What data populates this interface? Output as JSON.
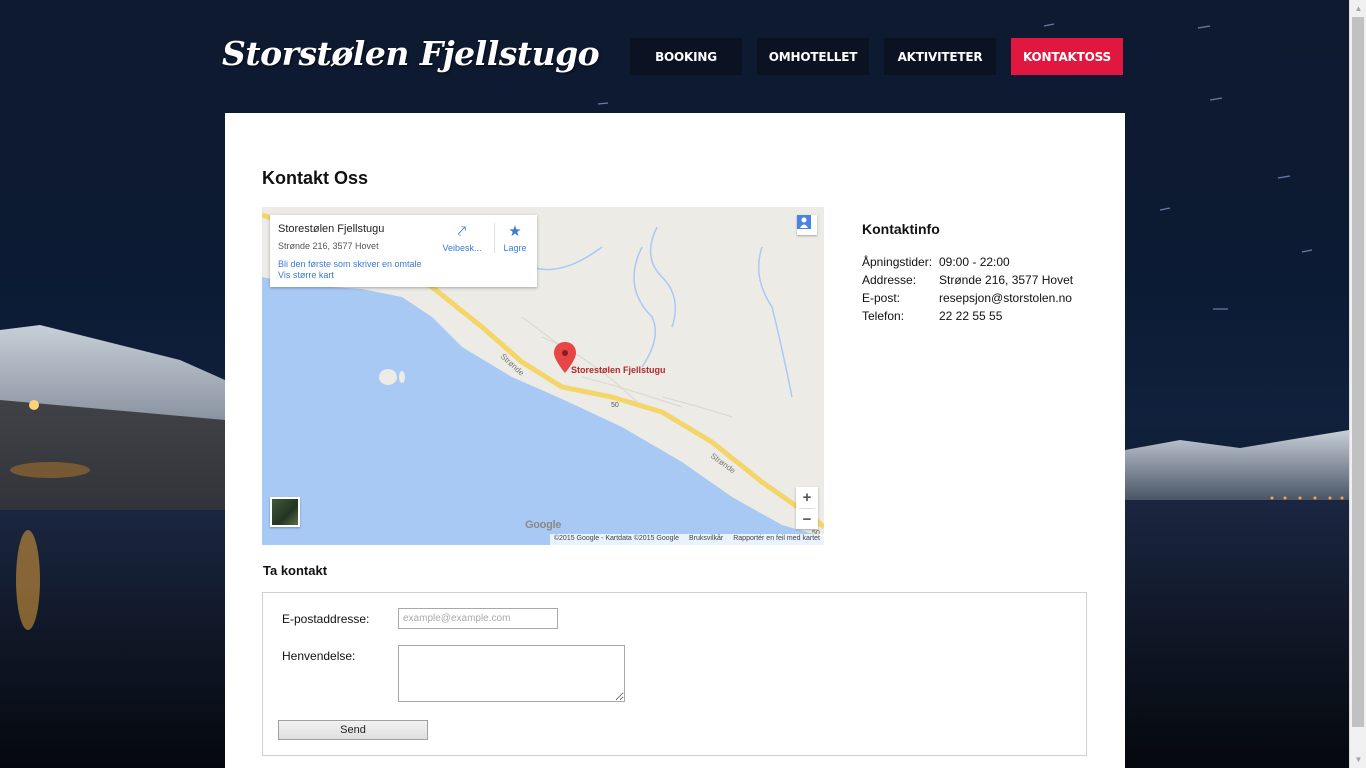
{
  "site": {
    "logo": "Storstølen Fjellstugo"
  },
  "nav": {
    "items": [
      {
        "label": "BOOKING",
        "active": false
      },
      {
        "label": "OMHOTELLET",
        "active": false
      },
      {
        "label": "AKTIVITETER",
        "active": false
      },
      {
        "label": "KONTAKTOSS",
        "active": true
      }
    ]
  },
  "colors": {
    "accent": "#e0173f",
    "nav_bg": "#0b1323"
  },
  "page": {
    "title": "Kontakt Oss"
  },
  "map": {
    "place_name": "Storestølen Fjellstugu",
    "address": "Strønde 216, 3577 Hovet",
    "directions_label": "Veibesk...",
    "save_label": "Lagre",
    "review_link": "Bli den første som skriver en omtale",
    "larger_map_link": "Vis større kart",
    "pin_label": "Storestølen Fjellstugu",
    "road_label_1": "Strønde",
    "road_label_2": "Strønde",
    "road_number": "50",
    "road_number_2": "50",
    "brand": "Google",
    "attribution": "©2015 Google - Kartdata ©2015 Google",
    "terms": "Bruksvilkår",
    "report": "Rapportér en feil med kartet",
    "zoom_in": "+",
    "zoom_out": "−"
  },
  "contact_info": {
    "title": "Kontaktinfo",
    "rows": [
      {
        "key": "Åpningstider:",
        "value": "09:00 - 22:00"
      },
      {
        "key": "Addresse:",
        "value": "Strønde 216, 3577 Hovet"
      },
      {
        "key": "E-post:",
        "value": "resepsjon@storstolen.no"
      },
      {
        "key": "Telefon:",
        "value": "22 22 55 55"
      }
    ]
  },
  "form": {
    "title": "Ta kontakt",
    "email_label": "E-postaddresse:",
    "email_placeholder": "example@example.com",
    "message_label": "Henvendelse:",
    "send_label": "Send"
  }
}
